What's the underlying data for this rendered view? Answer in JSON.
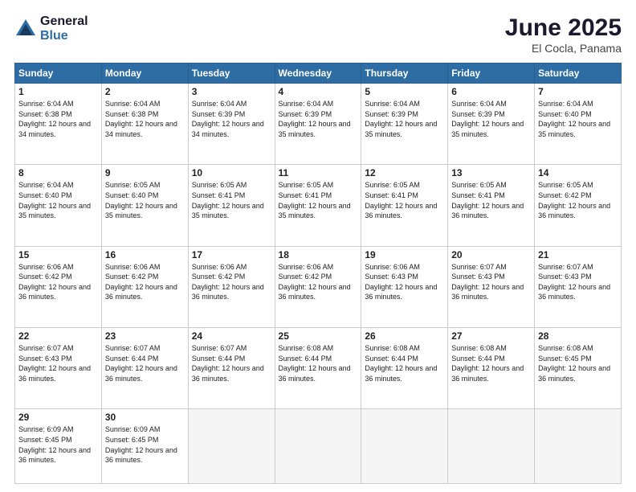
{
  "logo": {
    "general": "General",
    "blue": "Blue"
  },
  "title": {
    "month": "June 2025",
    "location": "El Cocla, Panama"
  },
  "days_header": [
    "Sunday",
    "Monday",
    "Tuesday",
    "Wednesday",
    "Thursday",
    "Friday",
    "Saturday"
  ],
  "weeks": [
    [
      {
        "num": "1",
        "rise": "6:04 AM",
        "set": "6:38 PM",
        "daylight": "12 hours and 34 minutes."
      },
      {
        "num": "2",
        "rise": "6:04 AM",
        "set": "6:38 PM",
        "daylight": "12 hours and 34 minutes."
      },
      {
        "num": "3",
        "rise": "6:04 AM",
        "set": "6:39 PM",
        "daylight": "12 hours and 34 minutes."
      },
      {
        "num": "4",
        "rise": "6:04 AM",
        "set": "6:39 PM",
        "daylight": "12 hours and 35 minutes."
      },
      {
        "num": "5",
        "rise": "6:04 AM",
        "set": "6:39 PM",
        "daylight": "12 hours and 35 minutes."
      },
      {
        "num": "6",
        "rise": "6:04 AM",
        "set": "6:39 PM",
        "daylight": "12 hours and 35 minutes."
      },
      {
        "num": "7",
        "rise": "6:04 AM",
        "set": "6:40 PM",
        "daylight": "12 hours and 35 minutes."
      }
    ],
    [
      {
        "num": "8",
        "rise": "6:04 AM",
        "set": "6:40 PM",
        "daylight": "12 hours and 35 minutes."
      },
      {
        "num": "9",
        "rise": "6:05 AM",
        "set": "6:40 PM",
        "daylight": "12 hours and 35 minutes."
      },
      {
        "num": "10",
        "rise": "6:05 AM",
        "set": "6:41 PM",
        "daylight": "12 hours and 35 minutes."
      },
      {
        "num": "11",
        "rise": "6:05 AM",
        "set": "6:41 PM",
        "daylight": "12 hours and 35 minutes."
      },
      {
        "num": "12",
        "rise": "6:05 AM",
        "set": "6:41 PM",
        "daylight": "12 hours and 36 minutes."
      },
      {
        "num": "13",
        "rise": "6:05 AM",
        "set": "6:41 PM",
        "daylight": "12 hours and 36 minutes."
      },
      {
        "num": "14",
        "rise": "6:05 AM",
        "set": "6:42 PM",
        "daylight": "12 hours and 36 minutes."
      }
    ],
    [
      {
        "num": "15",
        "rise": "6:06 AM",
        "set": "6:42 PM",
        "daylight": "12 hours and 36 minutes."
      },
      {
        "num": "16",
        "rise": "6:06 AM",
        "set": "6:42 PM",
        "daylight": "12 hours and 36 minutes."
      },
      {
        "num": "17",
        "rise": "6:06 AM",
        "set": "6:42 PM",
        "daylight": "12 hours and 36 minutes."
      },
      {
        "num": "18",
        "rise": "6:06 AM",
        "set": "6:42 PM",
        "daylight": "12 hours and 36 minutes."
      },
      {
        "num": "19",
        "rise": "6:06 AM",
        "set": "6:43 PM",
        "daylight": "12 hours and 36 minutes."
      },
      {
        "num": "20",
        "rise": "6:07 AM",
        "set": "6:43 PM",
        "daylight": "12 hours and 36 minutes."
      },
      {
        "num": "21",
        "rise": "6:07 AM",
        "set": "6:43 PM",
        "daylight": "12 hours and 36 minutes."
      }
    ],
    [
      {
        "num": "22",
        "rise": "6:07 AM",
        "set": "6:43 PM",
        "daylight": "12 hours and 36 minutes."
      },
      {
        "num": "23",
        "rise": "6:07 AM",
        "set": "6:44 PM",
        "daylight": "12 hours and 36 minutes."
      },
      {
        "num": "24",
        "rise": "6:07 AM",
        "set": "6:44 PM",
        "daylight": "12 hours and 36 minutes."
      },
      {
        "num": "25",
        "rise": "6:08 AM",
        "set": "6:44 PM",
        "daylight": "12 hours and 36 minutes."
      },
      {
        "num": "26",
        "rise": "6:08 AM",
        "set": "6:44 PM",
        "daylight": "12 hours and 36 minutes."
      },
      {
        "num": "27",
        "rise": "6:08 AM",
        "set": "6:44 PM",
        "daylight": "12 hours and 36 minutes."
      },
      {
        "num": "28",
        "rise": "6:08 AM",
        "set": "6:45 PM",
        "daylight": "12 hours and 36 minutes."
      }
    ],
    [
      {
        "num": "29",
        "rise": "6:09 AM",
        "set": "6:45 PM",
        "daylight": "12 hours and 36 minutes."
      },
      {
        "num": "30",
        "rise": "6:09 AM",
        "set": "6:45 PM",
        "daylight": "12 hours and 36 minutes."
      },
      null,
      null,
      null,
      null,
      null
    ]
  ]
}
